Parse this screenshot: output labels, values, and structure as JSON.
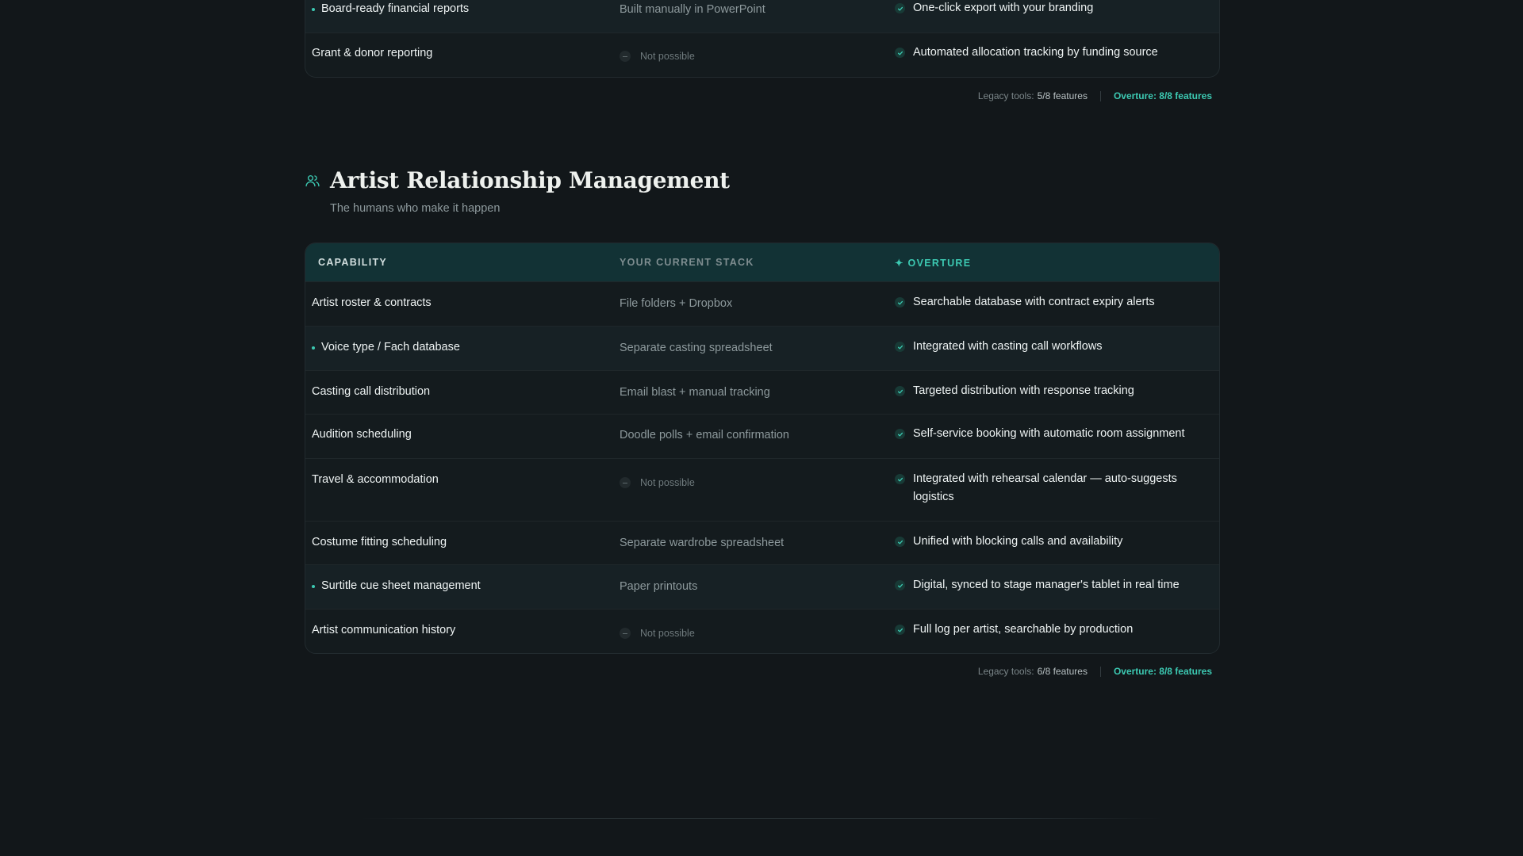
{
  "prev_section": {
    "rows": [
      {
        "capability": "Board-ready financial reports",
        "highlight": true,
        "current": "Built manually in PowerPoint",
        "current_missing": false,
        "overture": "One-click export with your branding"
      },
      {
        "capability": "Grant & donor reporting",
        "highlight": false,
        "current": "Not possible",
        "current_missing": true,
        "overture": "Automated allocation tracking by funding source"
      }
    ],
    "summary": {
      "legacy_label": "Legacy tools:",
      "legacy_value": "5/8 features",
      "overture": "Overture: 8/8 features"
    }
  },
  "section": {
    "icon": "users-icon",
    "title": "Artist Relationship Management",
    "subtitle": "The humans who make it happen",
    "headers": {
      "capability": "CAPABILITY",
      "current": "YOUR CURRENT STACK",
      "overture": "✦ OVERTURE"
    },
    "rows": [
      {
        "capability": "Artist roster & contracts",
        "highlight": false,
        "current": "File folders + Dropbox",
        "current_missing": false,
        "overture": "Searchable database with contract expiry alerts"
      },
      {
        "capability": "Voice type / Fach database",
        "highlight": true,
        "current": "Separate casting spreadsheet",
        "current_missing": false,
        "overture": "Integrated with casting call workflows"
      },
      {
        "capability": "Casting call distribution",
        "highlight": false,
        "current": "Email blast + manual tracking",
        "current_missing": false,
        "overture": "Targeted distribution with response tracking"
      },
      {
        "capability": "Audition scheduling",
        "highlight": false,
        "current": "Doodle polls + email confirmation",
        "current_missing": false,
        "overture": "Self-service booking with automatic room assignment"
      },
      {
        "capability": "Travel & accommodation",
        "highlight": false,
        "current": "Not possible",
        "current_missing": true,
        "overture": "Integrated with rehearsal calendar — auto-suggests logistics"
      },
      {
        "capability": "Costume fitting scheduling",
        "highlight": false,
        "current": "Separate wardrobe spreadsheet",
        "current_missing": false,
        "overture": "Unified with blocking calls and availability"
      },
      {
        "capability": "Surtitle cue sheet management",
        "highlight": true,
        "current": "Paper printouts",
        "current_missing": false,
        "overture": "Digital, synced to stage manager's tablet in real time"
      },
      {
        "capability": "Artist communication history",
        "highlight": false,
        "current": "Not possible",
        "current_missing": true,
        "overture": "Full log per artist, searchable by production"
      }
    ],
    "summary": {
      "legacy_label": "Legacy tools:",
      "legacy_value": "6/8 features",
      "overture": "Overture: 8/8 features"
    }
  },
  "colors": {
    "accent": "#3cc9b2",
    "background": "#12171a",
    "header_bg": "#123235"
  }
}
